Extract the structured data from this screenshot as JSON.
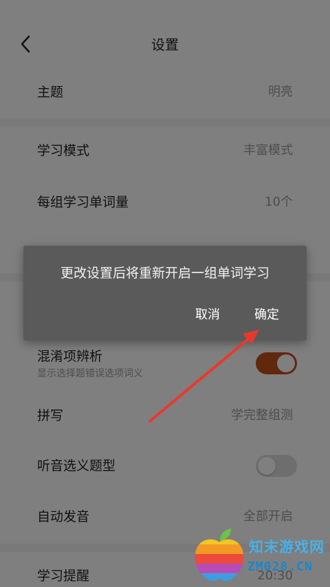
{
  "header": {
    "title": "设置",
    "back_icon": "chevron-left-icon"
  },
  "settings": {
    "theme": {
      "label": "主题",
      "value": "明亮"
    },
    "study_mode": {
      "label": "学习模式",
      "value": "丰富模式"
    },
    "words_per_group": {
      "label": "每组学习单词量",
      "value": "10个"
    },
    "confusion_analysis": {
      "label": "混淆项辨析",
      "sub": "显示选择题错误选项词义",
      "enabled": true
    },
    "spelling": {
      "label": "拼写",
      "value": "学完整组测"
    },
    "listening_question": {
      "label": "听音选义题型",
      "enabled": false
    },
    "auto_pronounce": {
      "label": "自动发音",
      "value": "全部开启"
    },
    "study_reminder": {
      "label": "学习提醒",
      "value": "20:30"
    }
  },
  "dialog": {
    "message": "更改设置后将重新开启一组单词学习",
    "cancel_label": "取消",
    "confirm_label": "确定"
  },
  "watermark": {
    "name": "知末游戏网",
    "domain": "ZM028.CN"
  },
  "colors": {
    "toggle_on": "#c0501a",
    "toggle_off": "#dcdcdc",
    "dialog_bg": "#5a5a5a",
    "arrow": "#e8392c",
    "watermark_text": "#4ab0e8"
  }
}
